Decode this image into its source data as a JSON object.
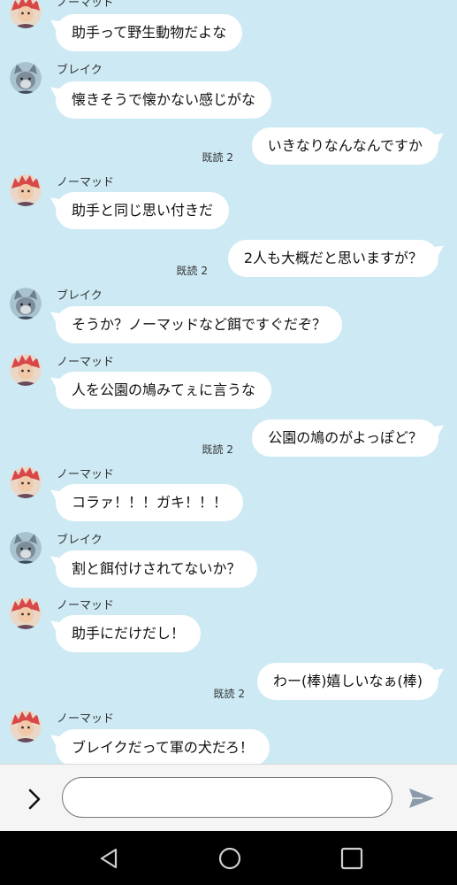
{
  "participants": {
    "nomad": {
      "name": "ノーマッド",
      "avatar_icon": "red-hair-character-avatar",
      "hair_color": "#d84848"
    },
    "blake": {
      "name": "ブレイク",
      "avatar_icon": "gray-wolf-character-avatar",
      "fur_color": "#6e7f8c"
    }
  },
  "messages": [
    {
      "side": "in",
      "sender": "ノーマッド",
      "text": "助手って野生動物だよな"
    },
    {
      "side": "in",
      "sender": "ブレイク",
      "text": "懐きそうで懐かない感じがな"
    },
    {
      "side": "out",
      "read": "既読 2",
      "text": "いきなりなんなんですか"
    },
    {
      "side": "in",
      "sender": "ノーマッド",
      "text": "助手と同じ思い付きだ"
    },
    {
      "side": "out",
      "read": "既読 2",
      "text": "2人も大概だと思いますが？"
    },
    {
      "side": "in",
      "sender": "ブレイク",
      "text": "そうか？ノーマッドなど餌ですぐだぞ？"
    },
    {
      "side": "in",
      "sender": "ノーマッド",
      "text": "人を公園の鳩みてぇに言うな"
    },
    {
      "side": "out",
      "read": "既読 2",
      "text": "公園の鳩のがよっぽど？"
    },
    {
      "side": "in",
      "sender": "ノーマッド",
      "text": "コラァ！！！ガキ！！！"
    },
    {
      "side": "in",
      "sender": "ブレイク",
      "text": "割と餌付けされてないか？"
    },
    {
      "side": "in",
      "sender": "ノーマッド",
      "text": "助手にだけだし！"
    },
    {
      "side": "out",
      "read": "既読 2",
      "text": "わー(棒)嬉しいなぁ(棒)"
    },
    {
      "side": "in",
      "sender": "ノーマッド",
      "text": "ブレイクだって軍の犬だろ！"
    }
  ],
  "input": {
    "value": "",
    "placeholder": "",
    "expand_icon": "chevron-right-icon",
    "send_icon": "send-icon"
  },
  "navbar": {
    "back_icon": "back-triangle-icon",
    "home_icon": "home-circle-icon",
    "recents_icon": "recents-square-icon"
  },
  "colors": {
    "chat_background": "#cdeaf4",
    "bubble": "#ffffff",
    "input_bar": "#f5f5f5",
    "navbar": "#000000"
  }
}
